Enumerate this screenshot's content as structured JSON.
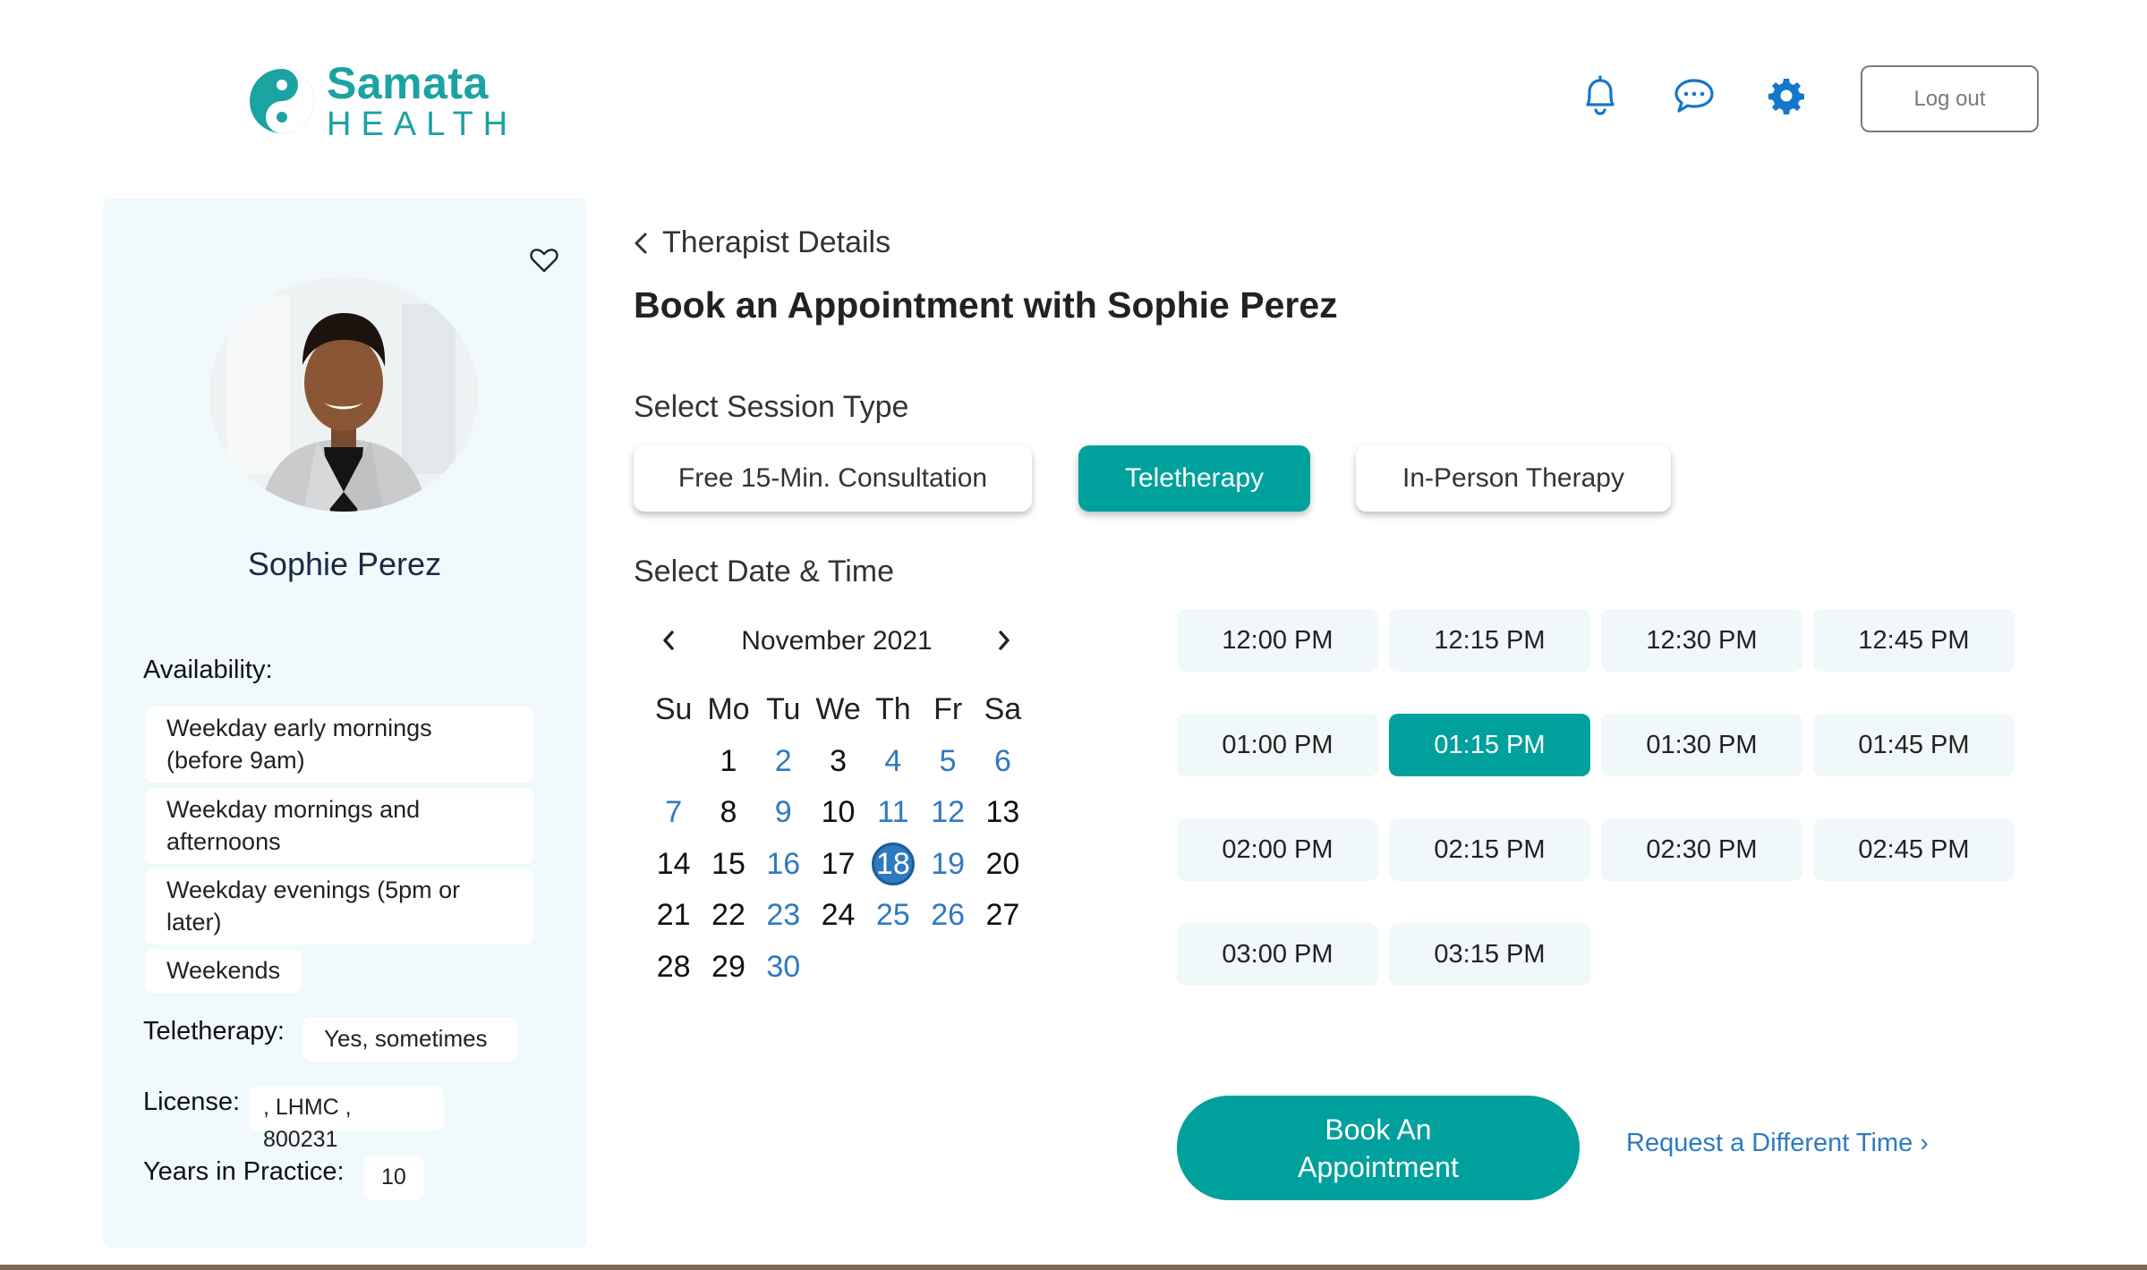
{
  "header": {
    "logo_primary": "Samata",
    "logo_secondary": "HEALTH",
    "logout_label": "Log out",
    "icons": [
      "bell-icon",
      "chat-icon",
      "gear-icon"
    ]
  },
  "therapist": {
    "name": "Sophie Perez",
    "availability_label": "Availability:",
    "availability": [
      "Weekday early mornings (before 9am)",
      "Weekday mornings and afternoons",
      "Weekday evenings (5pm or later)",
      "Weekends"
    ],
    "teletherapy_label": "Teletherapy:",
    "teletherapy_value": "Yes, sometimes",
    "license_label": "License:",
    "license_value": ", LHMC , 800231",
    "years_label": "Years in Practice:",
    "years_value": "10"
  },
  "main": {
    "back_label": "Therapist Details",
    "title": "Book an Appointment with Sophie Perez",
    "session_type_label": "Select Session Type",
    "session_types": [
      {
        "label": "Free 15-Min. Consultation",
        "active": false
      },
      {
        "label": "Teletherapy",
        "active": true
      },
      {
        "label": "In-Person Therapy",
        "active": false
      }
    ],
    "date_time_label": "Select Date & Time",
    "calendar": {
      "month": "November 2021",
      "weekdays": [
        "Su",
        "Mo",
        "Tu",
        "We",
        "Th",
        "Fr",
        "Sa"
      ],
      "first_weekday_offset": 1,
      "days": 30,
      "available_days": [
        2,
        4,
        5,
        6,
        7,
        9,
        11,
        12,
        16,
        19,
        23,
        25,
        26,
        30
      ],
      "selected_day": 18
    },
    "time_slots": [
      "12:00 PM",
      "12:15 PM",
      "12:30 PM",
      "12:45 PM",
      "01:00 PM",
      "01:15 PM",
      "01:30 PM",
      "01:45 PM",
      "02:00 PM",
      "02:15 PM",
      "02:30 PM",
      "02:45 PM",
      "03:00 PM",
      "03:15 PM"
    ],
    "selected_slot": "01:15 PM",
    "book_label": "Book An Appointment",
    "request_label": "Request a Different Time ›"
  },
  "colors": {
    "brand": "#1aa3a1",
    "accent": "#00a19c",
    "link": "#2e7ac0",
    "card_bg": "#f0f9fb"
  }
}
